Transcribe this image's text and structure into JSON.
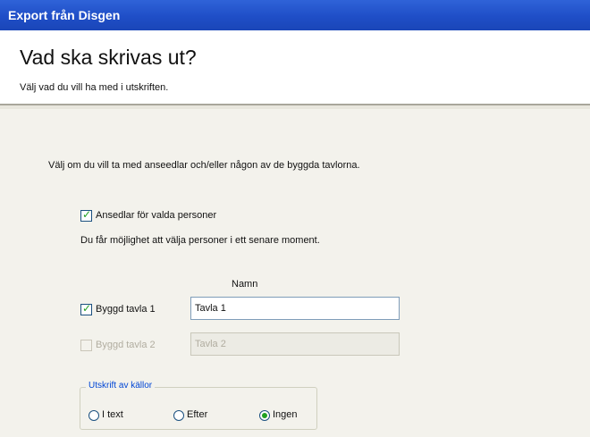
{
  "window": {
    "title": "Export från Disgen"
  },
  "header": {
    "title": "Vad ska skrivas ut?",
    "subtitle": "Välj vad du vill ha med i utskriften."
  },
  "main": {
    "instruction": "Välj om du vill ta med anseedlar och/eller någon av de byggda tavlorna.",
    "anseedlar": {
      "label": "Ansedlar för valda personer",
      "checked": true,
      "note": "Du får möjlighet att välja personer i ett senare moment."
    },
    "name_header": "Namn",
    "tavlor": [
      {
        "label": "Byggd tavla 1",
        "checked": true,
        "enabled": true,
        "value": "Tavla 1"
      },
      {
        "label": "Byggd tavla 2",
        "checked": false,
        "enabled": false,
        "value": "Tavla 2"
      }
    ],
    "sources": {
      "legend": "Utskrift av källor",
      "options": [
        {
          "label": "I text",
          "selected": false
        },
        {
          "label": "Efter",
          "selected": false
        },
        {
          "label": "Ingen",
          "selected": true
        }
      ]
    }
  }
}
